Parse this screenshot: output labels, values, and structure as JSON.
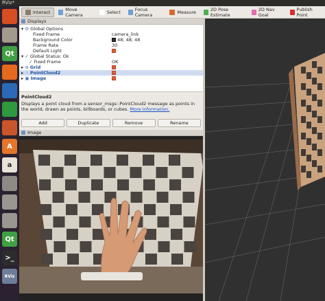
{
  "window": {
    "title": "RViz*"
  },
  "launcher": [
    {
      "name": "ubuntu-icon",
      "glyph": "",
      "color": "#d84d21"
    },
    {
      "name": "files-icon",
      "glyph": "",
      "color": "#a29b8c"
    },
    {
      "name": "qt-creator-icon",
      "glyph": "Qt",
      "color": "#41a043"
    },
    {
      "name": "firefox-icon",
      "glyph": "",
      "color": "#e66a1d"
    },
    {
      "name": "writer-icon",
      "glyph": "",
      "color": "#2a6ab7"
    },
    {
      "name": "calc-icon",
      "glyph": "",
      "color": "#2d9a3d"
    },
    {
      "name": "impress-icon",
      "glyph": "",
      "color": "#c8562a"
    },
    {
      "name": "software-center-icon",
      "glyph": "A",
      "color": "#e3762b"
    },
    {
      "name": "amazon-icon",
      "glyph": "a",
      "color": "#e8e3d8"
    },
    {
      "name": "settings-icon",
      "glyph": "",
      "color": "#8e8a84"
    },
    {
      "name": "drive-icon",
      "glyph": "",
      "color": "#9a9690"
    },
    {
      "name": "drive2-icon",
      "glyph": "",
      "color": "#9a9690"
    },
    {
      "name": "qt-creator2-icon",
      "glyph": "Qt",
      "color": "#41a043"
    },
    {
      "name": "terminal-icon",
      "glyph": ">_",
      "color": "#2c2c2c"
    },
    {
      "name": "rviz-icon",
      "glyph": "RViz",
      "color": "#6d7d9b"
    }
  ],
  "toolbar": [
    {
      "label": "Interact",
      "color": "#8a7f6e",
      "active": true
    },
    {
      "label": "Move Camera",
      "color": "#6fa0d6"
    },
    {
      "label": "Select",
      "color": "#ffffff"
    },
    {
      "label": "Focus Camera",
      "color": "#6fa0d6"
    },
    {
      "label": "Measure",
      "color": "#d66a2a"
    },
    {
      "label": "2D Pose Estimate",
      "color": "#4caf50"
    },
    {
      "label": "2D Nav Goal",
      "color": "#e66bb0"
    },
    {
      "label": "Publish Point",
      "color": "#d4302e"
    }
  ],
  "displays": {
    "header": "Displays",
    "global_options": "Global Options",
    "fixed_frame_label": "Fixed Frame",
    "fixed_frame_value": "camera_link",
    "background_color_label": "Background Color",
    "background_color_value": "48; 48; 48",
    "frame_rate_label": "Frame Rate",
    "frame_rate_value": "30",
    "default_light_label": "Default Light",
    "global_status": "Global Status: Ok",
    "status_fixed_frame_label": "Fixed Frame",
    "status_fixed_frame_value": "OK",
    "grid": "Grid",
    "pointcloud2": "PointCloud2",
    "image": "Image"
  },
  "description": {
    "title": "PointCloud2",
    "text": "Displays a point cloud from a sensor_msgs::PointCloud2 message as points in the world, drawn as points, billboards, or cubes.",
    "link": "More Information."
  },
  "buttons": {
    "add": "Add",
    "duplicate": "Duplicate",
    "remove": "Remove",
    "rename": "Rename"
  },
  "image_panel": {
    "header": "Image"
  },
  "colors": {
    "background": "#303030"
  }
}
